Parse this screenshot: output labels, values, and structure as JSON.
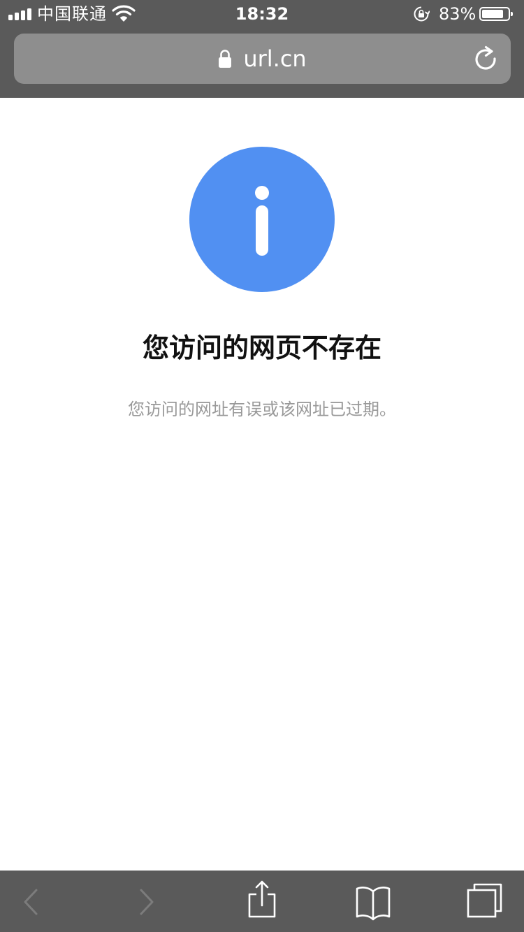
{
  "status_bar": {
    "carrier": "中国联通",
    "time": "18:32",
    "battery_percent_text": "83%",
    "battery_level": 0.83,
    "signal_bars": 4
  },
  "browser": {
    "url": "url.cn",
    "secure": true
  },
  "content": {
    "title": "您访问的网页不存在",
    "message": "您访问的网址有误或该网址已过期。"
  },
  "toolbar": {
    "buttons": [
      "back",
      "forward",
      "share",
      "bookmarks",
      "tabs"
    ],
    "back_enabled": false,
    "forward_enabled": false
  },
  "icons": {
    "signal": "signal-icon",
    "wifi": "wifi-icon",
    "rotation_lock": "rotation-lock-icon",
    "battery": "battery-icon",
    "lock": "lock-icon",
    "reload": "reload-icon",
    "info": "info-icon",
    "back": "chevron-left-icon",
    "forward": "chevron-right-icon",
    "share": "share-icon",
    "bookmarks": "book-icon",
    "tabs": "tabs-icon"
  },
  "colors": {
    "chrome_background": "#5a5a5a",
    "address_bar": "#8e8e8e",
    "info_icon": "#5190f2",
    "title": "#111111",
    "message": "#999999",
    "toolbar_icon": "#ffffff",
    "toolbar_icon_disabled": "#7c7c7c"
  }
}
